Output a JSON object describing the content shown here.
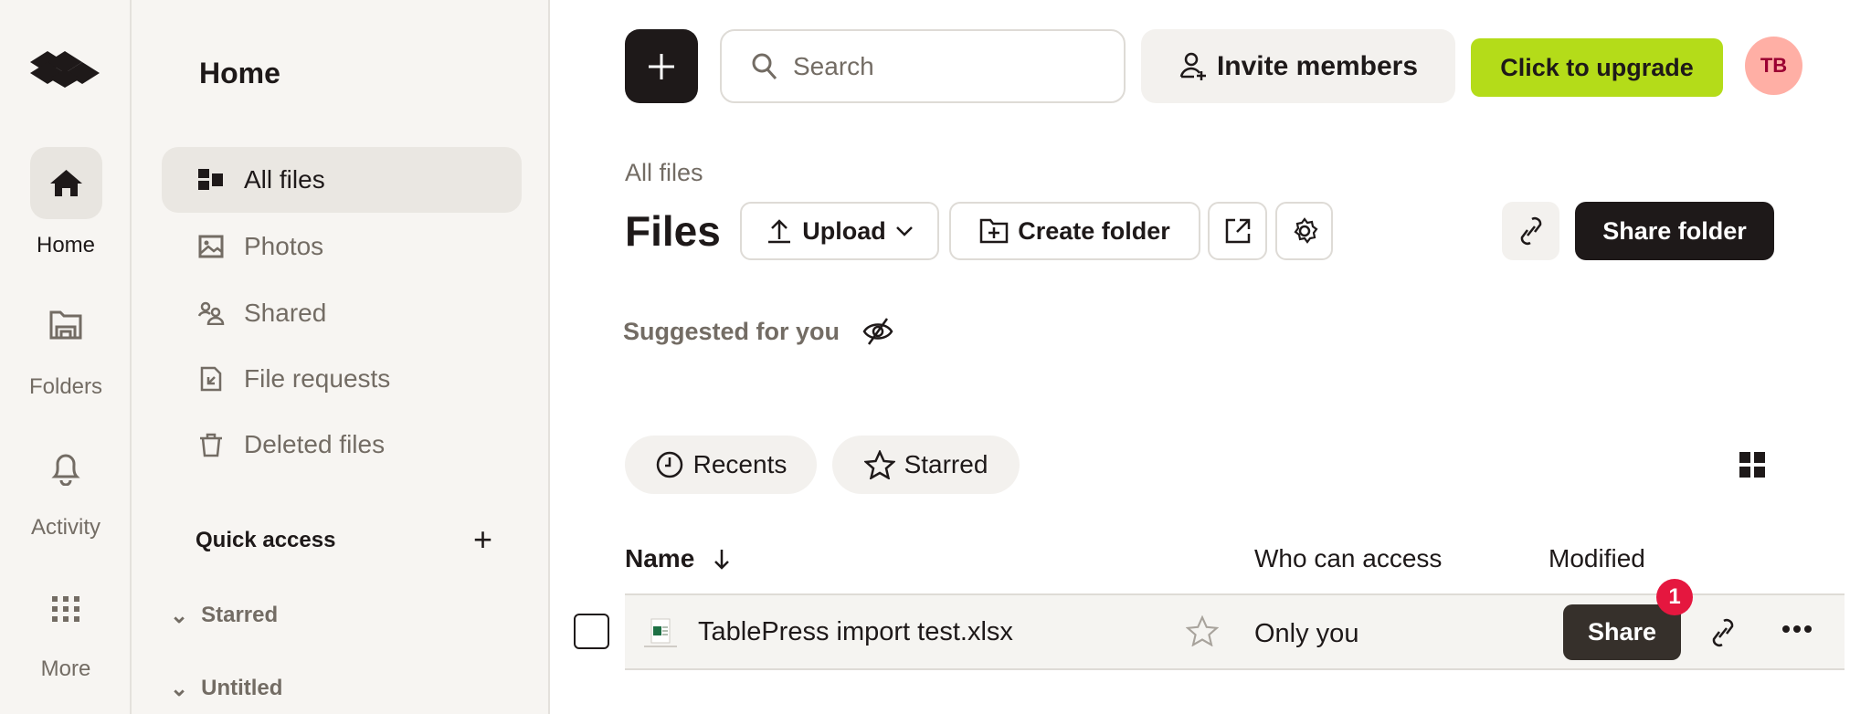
{
  "rail": {
    "items": [
      {
        "label": "Home",
        "icon": "home-icon"
      },
      {
        "label": "Folders",
        "icon": "folder-icon"
      },
      {
        "label": "Activity",
        "icon": "bell-icon"
      },
      {
        "label": "More",
        "icon": "grid-dots-icon"
      }
    ]
  },
  "sidebar": {
    "title": "Home",
    "items": [
      {
        "label": "All files"
      },
      {
        "label": "Photos"
      },
      {
        "label": "Shared"
      },
      {
        "label": "File requests"
      },
      {
        "label": "Deleted files"
      }
    ],
    "quick_access": "Quick access",
    "sections": [
      "Starred",
      "Untitled"
    ]
  },
  "topbar": {
    "search_placeholder": "Search",
    "invite": "Invite members",
    "upgrade": "Click to upgrade",
    "avatar": "TB"
  },
  "colors": {
    "upgrade": "#b4dc19",
    "avatar": "#ffafa5",
    "avatar_text": "#9b0032",
    "badge": "#e5173f"
  },
  "main": {
    "breadcrumb": "All files",
    "title": "Files",
    "upload": "Upload",
    "create_folder": "Create folder",
    "share_folder": "Share folder",
    "suggested": "Suggested for you",
    "tabs": [
      "Recents",
      "Starred"
    ],
    "columns": [
      "Name",
      "Who can access",
      "Modified"
    ],
    "rows": [
      {
        "name": "TablePress import test.xlsx",
        "access": "Only you",
        "share": "Share",
        "badge": "1"
      }
    ]
  }
}
